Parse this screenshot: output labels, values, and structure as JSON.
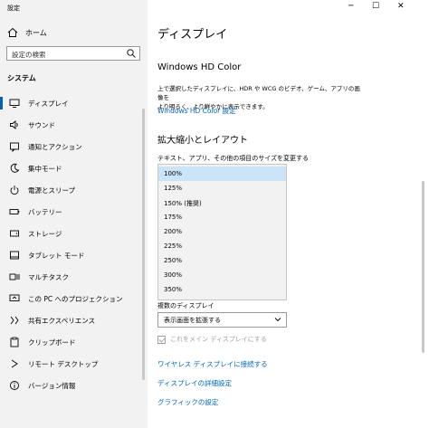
{
  "window": {
    "title": "設定",
    "minimize": "─",
    "maximize": "☐",
    "close": "✕"
  },
  "sidebar": {
    "home": "ホーム",
    "search_placeholder": "設定の検索",
    "section": "システム",
    "items": [
      {
        "label": "ディスプレイ",
        "icon": "monitor-icon",
        "active": true
      },
      {
        "label": "サウンド",
        "icon": "speaker-icon"
      },
      {
        "label": "通知とアクション",
        "icon": "notification-icon"
      },
      {
        "label": "集中モード",
        "icon": "moon-icon"
      },
      {
        "label": "電源とスリープ",
        "icon": "power-icon"
      },
      {
        "label": "バッテリー",
        "icon": "battery-icon"
      },
      {
        "label": "ストレージ",
        "icon": "storage-icon"
      },
      {
        "label": "タブレット モード",
        "icon": "tablet-icon"
      },
      {
        "label": "マルチタスク",
        "icon": "multitask-icon"
      },
      {
        "label": "この PC へのプロジェクション",
        "icon": "projection-icon"
      },
      {
        "label": "共有エクスペリエンス",
        "icon": "share-icon"
      },
      {
        "label": "クリップボード",
        "icon": "clipboard-icon"
      },
      {
        "label": "リモート デスクトップ",
        "icon": "remote-icon"
      },
      {
        "label": "バージョン情報",
        "icon": "info-icon"
      }
    ]
  },
  "main": {
    "title": "ディスプレイ",
    "hd_color": {
      "heading": "Windows HD Color",
      "desc_line1": "上で選択したディスプレイに、HDR や WCG のビデオ、ゲーム、アプリの画像を",
      "desc_line2": "より明るく、より鮮やかに表示できます。",
      "link": "Windows HD Color 設定"
    },
    "scale": {
      "heading": "拡大縮小とレイアウト",
      "label": "テキスト、アプリ、その他の項目のサイズを変更する",
      "options": [
        "100%",
        "125%",
        "150% (推奨)",
        "175%",
        "200%",
        "225%",
        "250%",
        "300%",
        "350%"
      ],
      "selected_index": 0
    },
    "multi": {
      "label": "複数のディスプレイ",
      "value": "表示画面を拡張する",
      "checkbox": "これをメイン ディスプレイにする"
    },
    "links": [
      "ワイヤレス ディスプレイに接続する",
      "ディスプレイの詳細設定",
      "グラフィックの設定"
    ]
  }
}
